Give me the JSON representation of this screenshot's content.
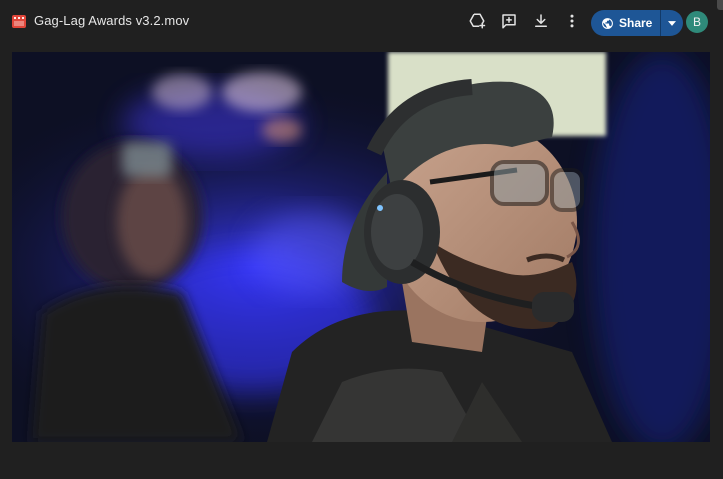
{
  "window": {
    "title": "Gag-Lag Awards v3.2.mov",
    "file_type_icon": "video-file-icon"
  },
  "toolbar": {
    "actions": [
      {
        "name": "add-to-drive-icon"
      },
      {
        "name": "add-comment-icon"
      },
      {
        "name": "download-icon"
      },
      {
        "name": "more-options-icon"
      }
    ],
    "share_label": "Share",
    "share_icon": "globe-icon",
    "share_menu_icon": "chevron-down-icon",
    "avatar_initial": "B"
  },
  "colors": {
    "background": "#202020",
    "share_button": "#1e5696",
    "avatar": "#2f8a7a",
    "file_icon": "#e0463a"
  },
  "preview": {
    "content": "video-frame"
  }
}
